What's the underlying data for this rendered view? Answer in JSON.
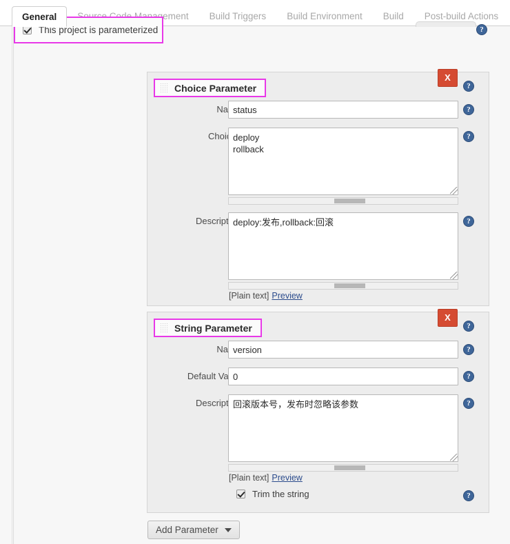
{
  "tabs": [
    {
      "label": "General",
      "active": true
    },
    {
      "label": "Source Code Management",
      "active": false
    },
    {
      "label": "Build Triggers",
      "active": false
    },
    {
      "label": "Build Environment",
      "active": false
    },
    {
      "label": "Build",
      "active": false
    },
    {
      "label": "Post-build Actions",
      "active": false
    }
  ],
  "parameterized": {
    "label": "This project is parameterized",
    "checked": true
  },
  "colors": {
    "highlight": "#e838e8",
    "delete_button": "#d54b32",
    "help_icon": "#3f6699",
    "link": "#2b4b8c"
  },
  "panels": [
    {
      "title": "Choice Parameter",
      "delete_label": "X",
      "fields": {
        "name_label": "Name",
        "name_value": "status",
        "choices_label": "Choices",
        "choices_value": "deploy\nrollback",
        "description_label": "Description",
        "description_value": "deploy:发布,rollback:回滚"
      },
      "markup_note": "[Plain text]",
      "preview_link": "Preview"
    },
    {
      "title": "String Parameter",
      "delete_label": "X",
      "fields": {
        "name_label": "Name",
        "name_value": "version",
        "default_label": "Default Value",
        "default_value": "0",
        "description_label": "Description",
        "description_value": "回滚版本号，发布时忽略该参数"
      },
      "markup_note": "[Plain text]",
      "preview_link": "Preview",
      "trim_label": "Trim the string",
      "trim_checked": true
    }
  ],
  "add_parameter": {
    "label": "Add Parameter"
  },
  "help_icon_glyph": "?"
}
